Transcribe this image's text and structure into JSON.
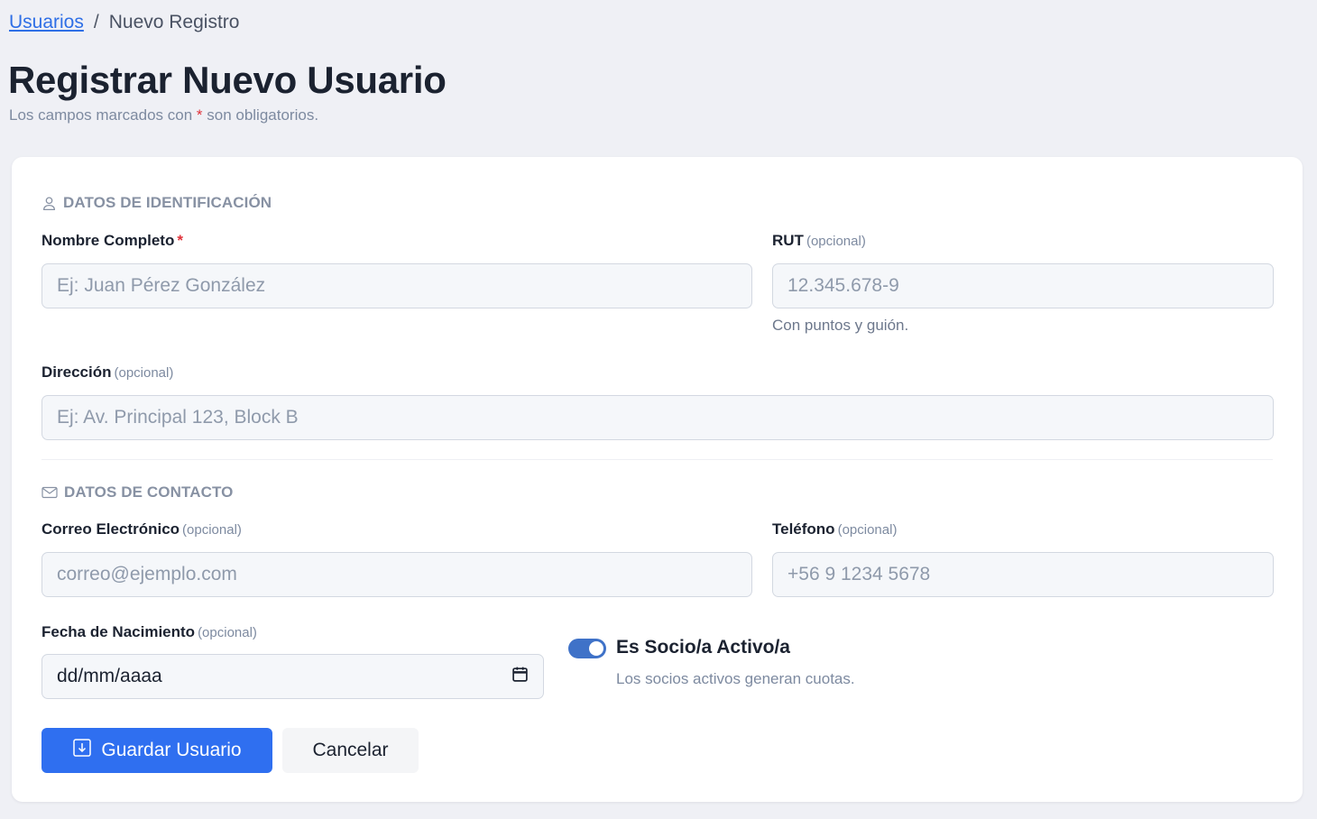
{
  "breadcrumb": {
    "parent": "Usuarios",
    "separator": "/",
    "current": "Nuevo Registro"
  },
  "header": {
    "title": "Registrar Nuevo Usuario",
    "subtitle_before": "Los campos marcados con ",
    "subtitle_star": "*",
    "subtitle_after": " son obligatorios."
  },
  "sections": {
    "identification": {
      "title": "DATOS DE IDENTIFICACIÓN",
      "icon": "user-icon"
    },
    "contact": {
      "title": "DATOS DE CONTACTO",
      "icon": "envelope-icon"
    }
  },
  "fields": {
    "full_name": {
      "label": "Nombre Completo",
      "required_mark": "*",
      "placeholder": "Ej: Juan Pérez González",
      "value": ""
    },
    "rut": {
      "label": "RUT",
      "optional": "(opcional)",
      "placeholder": "12.345.678-9",
      "value": "",
      "help": "Con puntos y guión."
    },
    "address": {
      "label": "Dirección",
      "optional": "(opcional)",
      "placeholder": "Ej: Av. Principal 123, Block B",
      "value": ""
    },
    "email": {
      "label": "Correo Electrónico",
      "optional": "(opcional)",
      "placeholder": "correo@ejemplo.com",
      "value": ""
    },
    "phone": {
      "label": "Teléfono",
      "optional": "(opcional)",
      "placeholder": "+56 9 1234 5678",
      "value": ""
    },
    "birth_date": {
      "label": "Fecha de Nacimiento",
      "optional": "(opcional)",
      "display": "dd/mm/aaaa",
      "icon": "calendar-icon"
    }
  },
  "active_member": {
    "label": "Es Socio/a Activo/a",
    "help": "Los socios activos generan cuotas.",
    "checked": true
  },
  "actions": {
    "save_label": "Guardar Usuario",
    "save_icon": "download-icon",
    "cancel_label": "Cancelar"
  },
  "colors": {
    "primary": "#2f6ff0",
    "toggle_on": "#3f72c8",
    "required": "#e0323a",
    "link": "#2f6fe6"
  }
}
